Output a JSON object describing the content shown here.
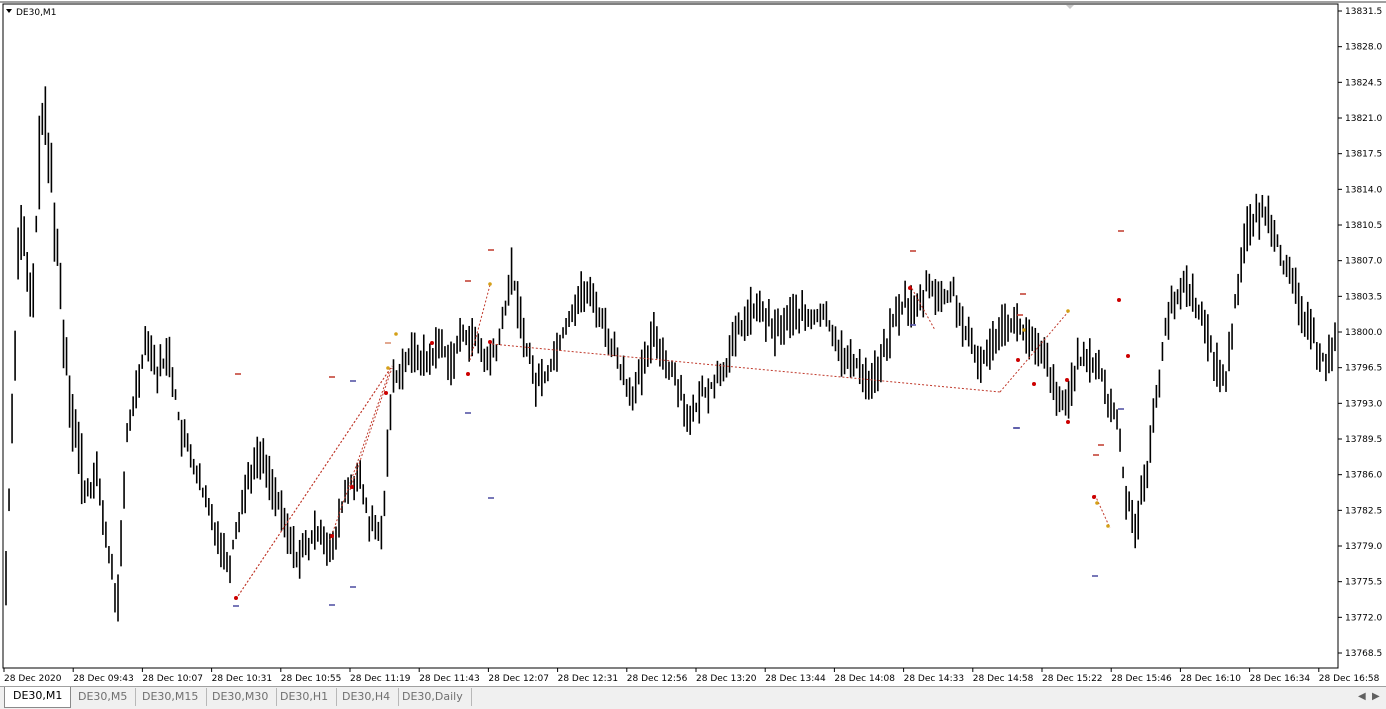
{
  "window": {
    "symbol_label": "DE30,M1",
    "symbol_icon": "triangle-down-icon"
  },
  "price_axis": {
    "labels": [
      "13831.5",
      "13828.0",
      "13824.5",
      "13821.0",
      "13817.5",
      "13814.0",
      "13810.5",
      "13807.0",
      "13803.5",
      "13800.0",
      "13796.5",
      "13793.0",
      "13789.5",
      "13786.0",
      "13782.5",
      "13779.0",
      "13775.5",
      "13772.0",
      "13768.5"
    ]
  },
  "time_axis": {
    "labels": [
      "28 Dec 2020",
      "28 Dec 09:43",
      "28 Dec 10:07",
      "28 Dec 10:31",
      "28 Dec 10:55",
      "28 Dec 11:19",
      "28 Dec 11:43",
      "28 Dec 12:07",
      "28 Dec 12:31",
      "28 Dec 12:56",
      "28 Dec 13:20",
      "28 Dec 13:44",
      "28 Dec 14:08",
      "28 Dec 14:33",
      "28 Dec 14:58",
      "28 Dec 15:22",
      "28 Dec 15:46",
      "28 Dec 16:10",
      "28 Dec 16:34",
      "28 Dec 16:58"
    ]
  },
  "chart_data": {
    "type": "bar",
    "symbol": "DE30",
    "timeframe": "M1",
    "ylim": [
      13767,
      13833
    ],
    "price_path": [
      [
        0,
        13776
      ],
      [
        0.7,
        13812
      ],
      [
        1.3,
        13801
      ],
      [
        1.8,
        13822
      ],
      [
        2.3,
        13815
      ],
      [
        2.9,
        13800
      ],
      [
        3.5,
        13790
      ],
      [
        4.0,
        13784
      ],
      [
        4.6,
        13786
      ],
      [
        5.1,
        13779
      ],
      [
        5.6,
        13773
      ],
      [
        6.1,
        13790
      ],
      [
        6.6,
        13795
      ],
      [
        7.1,
        13800
      ],
      [
        7.6,
        13796
      ],
      [
        8.2,
        13798
      ],
      [
        8.8,
        13790
      ],
      [
        9.3,
        13788
      ],
      [
        9.9,
        13784
      ],
      [
        10.5,
        13781
      ],
      [
        11.2,
        13777
      ],
      [
        11.6,
        13781
      ],
      [
        12.2,
        13786
      ],
      [
        12.8,
        13788
      ],
      [
        13.4,
        13785
      ],
      [
        14.0,
        13781
      ],
      [
        14.6,
        13778
      ],
      [
        15.2,
        13779
      ],
      [
        15.8,
        13781
      ],
      [
        16.4,
        13778
      ],
      [
        17.0,
        13784
      ],
      [
        17.7,
        13786
      ],
      [
        18.3,
        13781
      ],
      [
        18.9,
        13780
      ],
      [
        19.4,
        13795
      ],
      [
        20.0,
        13797
      ],
      [
        20.6,
        13798
      ],
      [
        21.2,
        13797
      ],
      [
        21.8,
        13799
      ],
      [
        22.4,
        13797
      ],
      [
        23.0,
        13800
      ],
      [
        23.6,
        13799
      ],
      [
        24.2,
        13797
      ],
      [
        24.8,
        13799
      ],
      [
        25.4,
        13806
      ],
      [
        26.0,
        13800
      ],
      [
        26.6,
        13795
      ],
      [
        27.2,
        13796
      ],
      [
        27.8,
        13799
      ],
      [
        28.4,
        13802
      ],
      [
        29.0,
        13804
      ],
      [
        29.6,
        13803
      ],
      [
        30.2,
        13800
      ],
      [
        30.8,
        13797
      ],
      [
        31.4,
        13794
      ],
      [
        32.0,
        13796
      ],
      [
        32.6,
        13800
      ],
      [
        33.2,
        13797
      ],
      [
        33.8,
        13795
      ],
      [
        34.4,
        13791
      ],
      [
        35.0,
        13794
      ],
      [
        35.6,
        13795
      ],
      [
        36.2,
        13797
      ],
      [
        36.8,
        13800
      ],
      [
        37.4,
        13802
      ],
      [
        38.0,
        13802
      ],
      [
        38.6,
        13800
      ],
      [
        39.2,
        13801
      ],
      [
        39.8,
        13802
      ],
      [
        40.4,
        13801
      ],
      [
        41.0,
        13802
      ],
      [
        41.6,
        13800
      ],
      [
        42.2,
        13797
      ],
      [
        42.8,
        13797
      ],
      [
        43.4,
        13795
      ],
      [
        44.0,
        13797
      ],
      [
        44.6,
        13801
      ],
      [
        45.2,
        13803
      ],
      [
        45.8,
        13802
      ],
      [
        46.4,
        13805
      ],
      [
        47.0,
        13803
      ],
      [
        47.6,
        13804
      ],
      [
        48.2,
        13800
      ],
      [
        48.8,
        13797
      ],
      [
        49.4,
        13798
      ],
      [
        50.0,
        13801
      ],
      [
        50.6,
        13801
      ],
      [
        51.2,
        13800
      ],
      [
        51.8,
        13798
      ],
      [
        52.4,
        13797
      ],
      [
        52.8,
        13793
      ],
      [
        53.3,
        13793
      ],
      [
        53.8,
        13797
      ],
      [
        54.4,
        13797
      ],
      [
        54.9,
        13797
      ],
      [
        55.4,
        13793
      ],
      [
        55.8,
        13792
      ],
      [
        56.3,
        13784
      ],
      [
        56.8,
        13781
      ],
      [
        57.3,
        13786
      ],
      [
        57.8,
        13793
      ],
      [
        58.3,
        13801
      ],
      [
        58.8,
        13803
      ],
      [
        59.3,
        13805
      ],
      [
        59.8,
        13803
      ],
      [
        60.3,
        13800
      ],
      [
        60.8,
        13797
      ],
      [
        61.3,
        13795
      ],
      [
        61.8,
        13803
      ],
      [
        62.3,
        13810
      ],
      [
        62.8,
        13811
      ],
      [
        63.3,
        13812
      ],
      [
        63.8,
        13810
      ],
      [
        64.3,
        13806
      ],
      [
        64.8,
        13804
      ],
      [
        65.3,
        13801
      ],
      [
        65.8,
        13799
      ],
      [
        66.3,
        13797
      ],
      [
        66.8,
        13799
      ]
    ],
    "highlight_marks_note": "small red and blue horizontal dashes are trade/level markers drawn on the chart"
  },
  "tabs": [
    {
      "label": "DE30,M1",
      "active": true
    },
    {
      "label": "DE30,M5",
      "active": false
    },
    {
      "label": "DE30,M15",
      "active": false
    },
    {
      "label": "DE30,M30",
      "active": false
    },
    {
      "label": "DE30,H1",
      "active": false
    },
    {
      "label": "DE30,H4",
      "active": false
    },
    {
      "label": "DE30,Daily",
      "active": false
    }
  ],
  "colors": {
    "candle": "#000000",
    "trend_line": "#c0392b",
    "signal_up": "#d4a017",
    "signal_down": "#cc0000",
    "grid_border": "#000000"
  }
}
